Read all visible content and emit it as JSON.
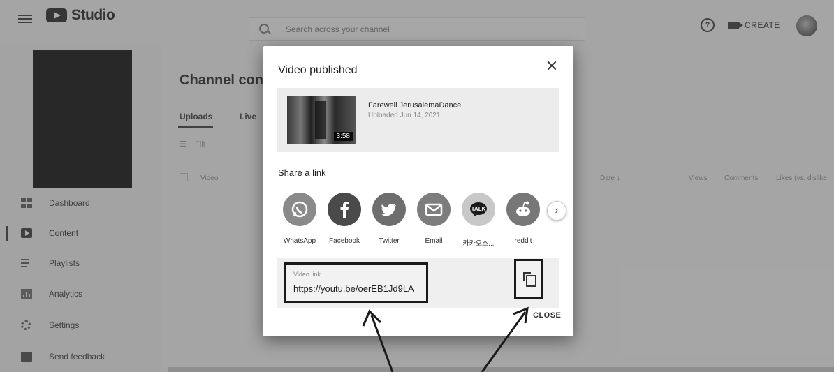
{
  "header": {
    "logo_text": "Studio",
    "search_placeholder": "Search across your channel",
    "create_label": "CREATE"
  },
  "sidebar": {
    "items": [
      {
        "label": "Dashboard",
        "icon": "dashboard-icon"
      },
      {
        "label": "Content",
        "icon": "content-icon",
        "active": true
      },
      {
        "label": "Playlists",
        "icon": "playlists-icon"
      },
      {
        "label": "Analytics",
        "icon": "analytics-icon"
      },
      {
        "label": "Settings",
        "icon": "settings-icon"
      },
      {
        "label": "Send feedback",
        "icon": "feedback-icon"
      }
    ]
  },
  "main": {
    "title": "Channel cont",
    "tabs": [
      "Uploads",
      "Live"
    ],
    "filter_label": "Filt",
    "columns": [
      "Video",
      "Date ↓",
      "Views",
      "Comments",
      "Likes (vs. dislike"
    ]
  },
  "modal": {
    "title": "Video published",
    "video": {
      "title": "Farewell JerusalemaDance",
      "uploaded": "Uploaded Jun 14, 2021",
      "duration": "3:58"
    },
    "share_label": "Share a link",
    "share_targets": [
      {
        "name": "WhatsApp",
        "icon": "whatsapp-icon",
        "color": "#8a8a8a"
      },
      {
        "name": "Facebook",
        "icon": "facebook-icon",
        "color": "#4a4a4a"
      },
      {
        "name": "Twitter",
        "icon": "twitter-icon",
        "color": "#6e6e6e"
      },
      {
        "name": "Email",
        "icon": "email-icon",
        "color": "#7d7d7d"
      },
      {
        "name": "카카오스...",
        "icon": "kakao-talk-icon",
        "color": "#c8c8c8"
      },
      {
        "name": "reddit",
        "icon": "reddit-icon",
        "color": "#777777"
      }
    ],
    "link_label": "Video link",
    "link_value": "https://youtu.be/oerEB1Jd9LA",
    "close_label": "CLOSE"
  },
  "colors": {
    "overlay": "#6a6a6a",
    "annotation": "#1a1a1a"
  }
}
